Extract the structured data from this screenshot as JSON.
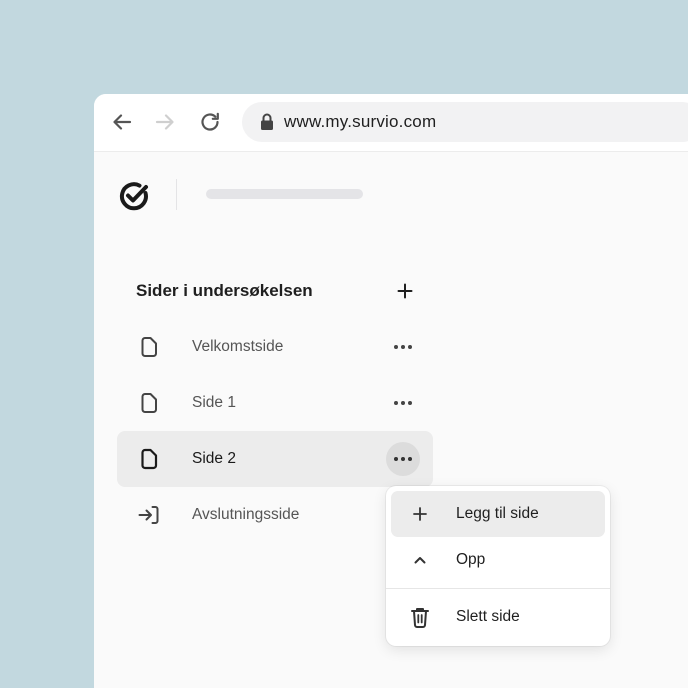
{
  "browser": {
    "url": "www.my.survio.com",
    "icons": [
      "back-arrow-icon",
      "forward-arrow-icon",
      "reload-icon",
      "lock-icon"
    ]
  },
  "app": {
    "logo_icon": "survio-check-logo-icon"
  },
  "sidebar": {
    "title": "Sider i undersøkelsen",
    "pages": [
      {
        "label": "Velkomstside",
        "icon": "page-icon",
        "active": false
      },
      {
        "label": "Side 1",
        "icon": "page-icon",
        "active": false
      },
      {
        "label": "Side 2",
        "icon": "page-icon",
        "active": true
      },
      {
        "label": "Avslutningsside",
        "icon": "exit-arrow-icon",
        "active": false
      }
    ]
  },
  "context_menu": {
    "items": [
      {
        "label": "Legg til side",
        "icon": "plus-icon"
      },
      {
        "label": "Opp",
        "icon": "chevron-up-icon"
      },
      {
        "label": "Slett side",
        "icon": "trash-icon"
      }
    ]
  },
  "colors": {
    "background": "#c2d8df",
    "window": "#fafafa",
    "active_row": "#ececec",
    "text": "#1f1f1f"
  }
}
